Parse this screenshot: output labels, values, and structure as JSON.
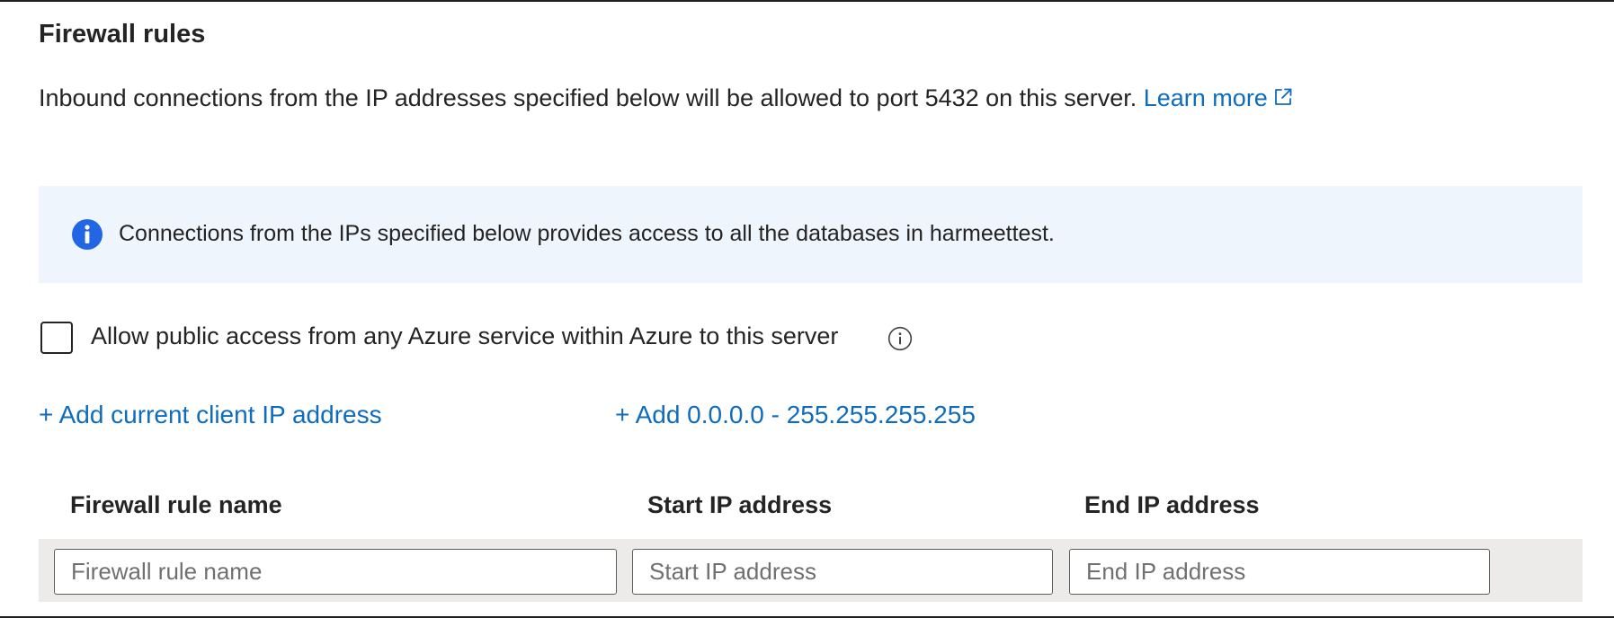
{
  "section": {
    "title": "Firewall rules",
    "description": "Inbound connections from the IP addresses specified below will be allowed to port 5432 on this server.",
    "learn_more": "Learn more"
  },
  "info_banner": {
    "icon": "info-icon",
    "text": "Connections from the IPs specified below provides access to all the databases in harmeettest."
  },
  "azure_access": {
    "checked": false,
    "label": "Allow public access from any Azure service within Azure to this server",
    "icon": "info-outline-icon"
  },
  "actions": {
    "add_client_ip": "+ Add current client IP address",
    "add_full_range": "+ Add 0.0.0.0 - 255.255.255.255"
  },
  "table": {
    "columns": [
      "Firewall rule name",
      "Start IP address",
      "End IP address"
    ],
    "new_row": {
      "name": {
        "value": "",
        "placeholder": "Firewall rule name"
      },
      "start_ip": {
        "value": "",
        "placeholder": "Start IP address"
      },
      "end_ip": {
        "value": "",
        "placeholder": "End IP address"
      }
    }
  },
  "colors": {
    "link": "#0f6cbd",
    "info_bg": "#eff5fd",
    "info_icon": "#2266e3",
    "row_bg": "#edebe9"
  }
}
